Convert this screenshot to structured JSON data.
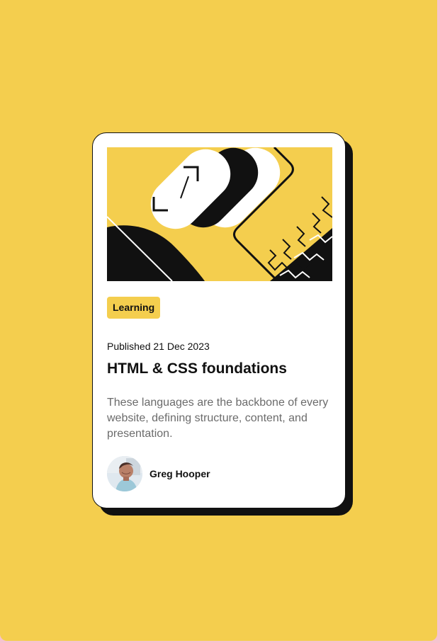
{
  "card": {
    "tag": "Learning",
    "published": "Published 21 Dec 2023",
    "title": "HTML & CSS foundations",
    "excerpt": "These languages are the backbone of every website, defining structure, content, and presentation.",
    "author": {
      "name": "Greg Hooper"
    }
  },
  "theme": {
    "page_background": "#f4ce4e",
    "outer_background": "#f6c3cf",
    "card_background": "#ffffff",
    "accent": "#f4ce4e",
    "text": "#111111",
    "muted_text": "#6b6b6b",
    "shadow": "#111111"
  },
  "images": {
    "hero": "hero-illustration",
    "avatar": "avatar-photo"
  }
}
